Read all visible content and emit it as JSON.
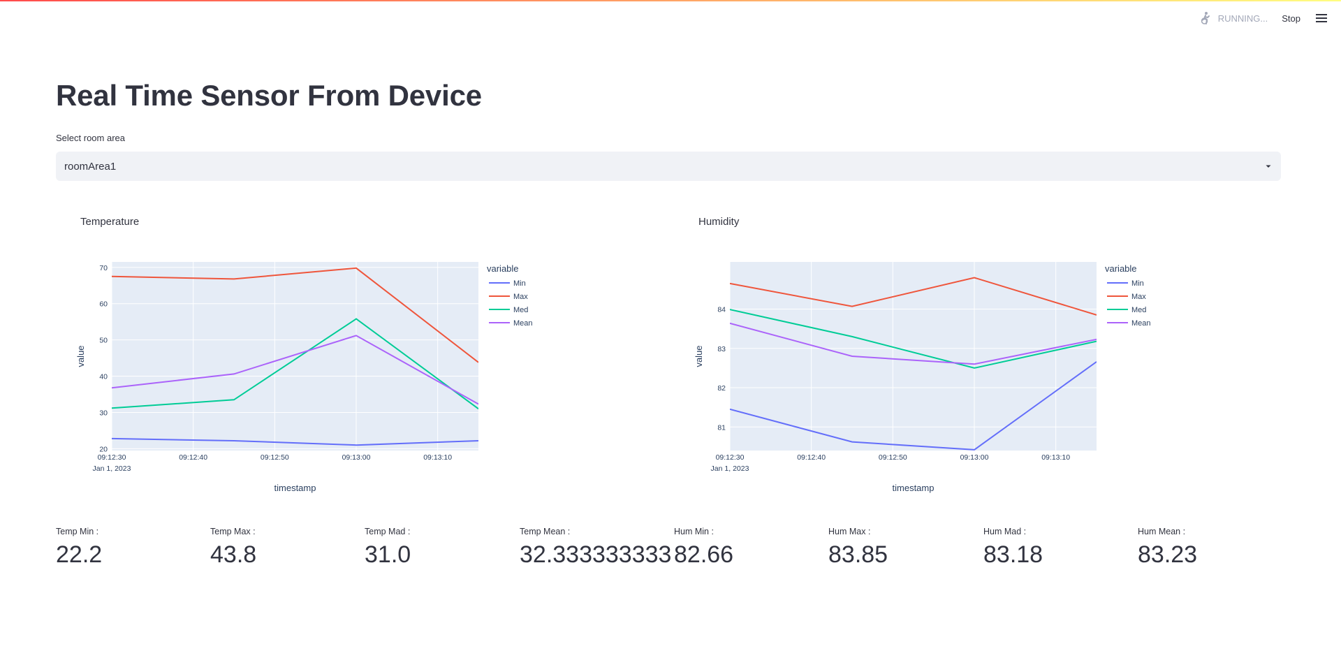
{
  "header": {
    "status_text": "RUNNING...",
    "stop_label": "Stop",
    "status_icon": "running-person-icon",
    "menu_icon": "hamburger-menu-icon"
  },
  "page": {
    "title": "Real Time Sensor From Device",
    "select_label": "Select room area",
    "select_value": "roomArea1"
  },
  "colors": {
    "accent_gradient_start": "#ff4b4b",
    "accent_gradient_end": "#fffd80",
    "Min": "#636efa",
    "Max": "#ef553b",
    "Med": "#00cc96",
    "Mean": "#ab63fa"
  },
  "chart_data": [
    {
      "type": "line",
      "title": "Temperature",
      "xlabel": "timestamp",
      "ylabel": "value",
      "x_tick_labels": [
        "09:12:30",
        "09:12:40",
        "09:12:50",
        "09:13:00",
        "09:13:10"
      ],
      "x_date_label": "Jan 1, 2023",
      "x": [
        "09:12:30",
        "09:12:45",
        "09:13:00",
        "09:13:15"
      ],
      "xlim": [
        "09:12:30",
        "09:13:15"
      ],
      "ylim": [
        19.5,
        71.5
      ],
      "y_ticks": [
        20,
        30,
        40,
        50,
        60,
        70
      ],
      "legend_title": "variable",
      "legend_position": "right",
      "series": [
        {
          "name": "Min",
          "values": [
            22.8,
            22.2,
            21.0,
            22.2
          ]
        },
        {
          "name": "Max",
          "values": [
            67.5,
            66.8,
            69.8,
            43.8
          ]
        },
        {
          "name": "Med",
          "values": [
            31.2,
            33.5,
            55.8,
            31.0
          ]
        },
        {
          "name": "Mean",
          "values": [
            36.8,
            40.6,
            51.2,
            32.3
          ]
        }
      ]
    },
    {
      "type": "line",
      "title": "Humidity",
      "xlabel": "timestamp",
      "ylabel": "value",
      "x_tick_labels": [
        "09:12:30",
        "09:12:40",
        "09:12:50",
        "09:13:00",
        "09:13:10"
      ],
      "x_date_label": "Jan 1, 2023",
      "x": [
        "09:12:30",
        "09:12:45",
        "09:13:00",
        "09:13:15"
      ],
      "xlim": [
        "09:12:30",
        "09:13:15"
      ],
      "ylim": [
        80.4,
        85.2
      ],
      "y_ticks": [
        81,
        82,
        83,
        84
      ],
      "legend_title": "variable",
      "legend_position": "right",
      "series": [
        {
          "name": "Min",
          "values": [
            81.45,
            80.62,
            80.42,
            82.66
          ]
        },
        {
          "name": "Max",
          "values": [
            84.65,
            84.07,
            84.8,
            83.85
          ]
        },
        {
          "name": "Med",
          "values": [
            83.99,
            83.3,
            82.5,
            83.18
          ]
        },
        {
          "name": "Mean",
          "values": [
            83.64,
            82.8,
            82.6,
            83.23
          ]
        }
      ]
    }
  ],
  "metrics": [
    {
      "label": "Temp Min :",
      "value": "22.2"
    },
    {
      "label": "Temp Max :",
      "value": "43.8"
    },
    {
      "label": "Temp Mad :",
      "value": "31.0"
    },
    {
      "label": "Temp Mean :",
      "value": "32.333333333"
    },
    {
      "label": "Hum Min :",
      "value": "82.66"
    },
    {
      "label": "Hum Max :",
      "value": "83.85"
    },
    {
      "label": "Hum Mad :",
      "value": "83.18"
    },
    {
      "label": "Hum Mean :",
      "value": "83.23"
    }
  ]
}
